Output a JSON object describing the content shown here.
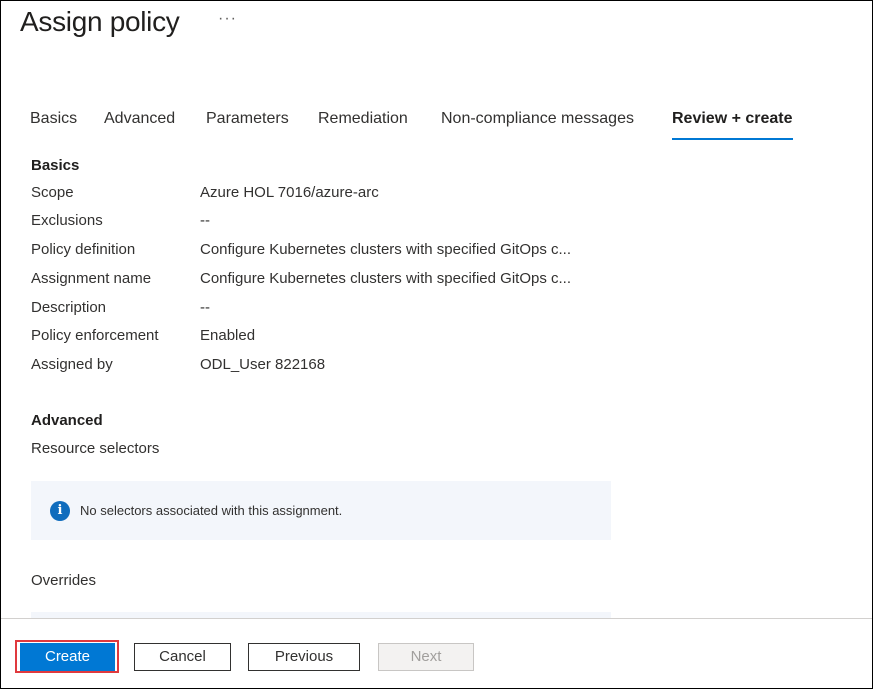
{
  "header": {
    "title": "Assign policy",
    "more": "···"
  },
  "tabs": [
    {
      "label": "Basics",
      "active": false
    },
    {
      "label": "Advanced",
      "active": false
    },
    {
      "label": "Parameters",
      "active": false
    },
    {
      "label": "Remediation",
      "active": false
    },
    {
      "label": "Non-compliance messages",
      "active": false
    },
    {
      "label": "Review + create",
      "active": true
    }
  ],
  "basics": {
    "heading": "Basics",
    "rows": [
      {
        "label": "Scope",
        "value": "Azure HOL 7016/azure-arc"
      },
      {
        "label": "Exclusions",
        "value": "--"
      },
      {
        "label": "Policy definition",
        "value": "Configure Kubernetes clusters with specified GitOps c..."
      },
      {
        "label": "Assignment name",
        "value": "Configure Kubernetes clusters with specified GitOps c..."
      },
      {
        "label": "Description",
        "value": "--"
      },
      {
        "label": "Policy enforcement",
        "value": "Enabled"
      },
      {
        "label": "Assigned by",
        "value": "ODL_User 822168"
      }
    ]
  },
  "advanced": {
    "heading": "Advanced",
    "resource_selectors_label": "Resource selectors",
    "info_icon": "info-icon",
    "info_glyph": "i",
    "info_text": "No selectors associated with this assignment.",
    "overrides_label": "Overrides"
  },
  "footer": {
    "create": "Create",
    "cancel": "Cancel",
    "previous": "Previous",
    "next": "Next"
  },
  "colors": {
    "accent": "#0078d4",
    "highlight": "#e0393e",
    "info_bg": "#f3f6fb"
  }
}
